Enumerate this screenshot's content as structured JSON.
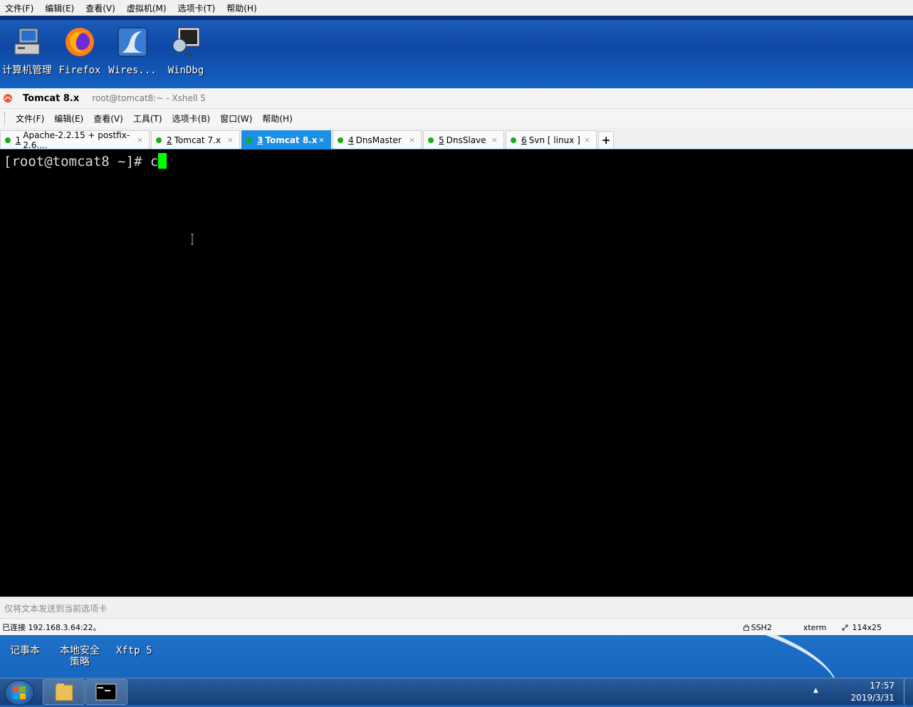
{
  "vm_menu": [
    "文件(F)",
    "编辑(E)",
    "查看(V)",
    "虚拟机(M)",
    "选项卡(T)",
    "帮助(H)"
  ],
  "desktop_top_icons": [
    {
      "label": "计算机管理",
      "icon": "computer-management-icon"
    },
    {
      "label": "Firefox",
      "icon": "firefox-icon"
    },
    {
      "label": "Wires...",
      "icon": "wireshark-icon"
    },
    {
      "label": "WinDbg",
      "icon": "windbg-icon"
    }
  ],
  "xshell": {
    "title": "Tomcat 8.x",
    "subtitle": "root@tomcat8:~ - Xshell 5",
    "menu": [
      "文件(F)",
      "编辑(E)",
      "查看(V)",
      "工具(T)",
      "选项卡(B)",
      "窗口(W)",
      "帮助(H)"
    ],
    "tabs": [
      {
        "num": "1",
        "label": "Apache-2.2.15 + postfix-2.6....",
        "active": false
      },
      {
        "num": "2",
        "label": "Tomcat 7.x",
        "active": false
      },
      {
        "num": "3",
        "label": "Tomcat 8.x",
        "active": true
      },
      {
        "num": "4",
        "label": "DnsMaster",
        "active": false
      },
      {
        "num": "5",
        "label": "DnsSlave",
        "active": false
      },
      {
        "num": "6",
        "label": "Svn [ linux ]",
        "active": false
      }
    ],
    "add_tab": "+",
    "close_glyph": "×",
    "terminal": {
      "prompt": "[root@tomcat8 ~]# ",
      "input": "c"
    },
    "send_bar_placeholder": "仅将文本发送到当前选项卡",
    "status": {
      "connection": "已连接 192.168.3.64:22。",
      "protocol": "SSH2",
      "terminal_type": "xterm",
      "size": "114x25"
    }
  },
  "desktop_bottom_icons": [
    {
      "label": "记事本",
      "icon": "notepad-icon"
    },
    {
      "label": "本地安全策略",
      "icon": "security-policy-icon"
    },
    {
      "label": "Xftp 5",
      "icon": "xftp-icon"
    }
  ],
  "taskbar": {
    "time": "17:57",
    "date": "2019/3/31",
    "tray_arrow": "▲"
  },
  "colors": {
    "tab_active": "#1b8fe3",
    "cursor": "#00ff00",
    "status_dot": "#12b012"
  }
}
